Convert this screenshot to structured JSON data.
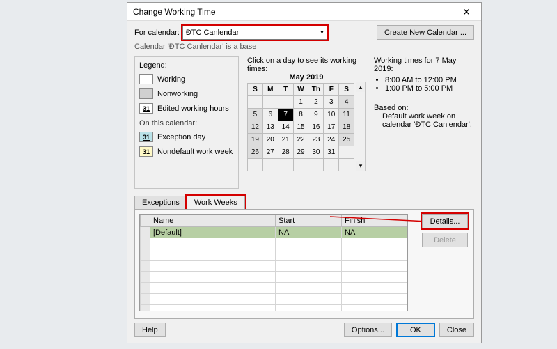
{
  "dialog": {
    "title": "Change Working Time"
  },
  "row1": {
    "forCalendarLabel": "For calendar:",
    "selectedCalendar": "ĐTC Canlendar",
    "createNewBtn": "Create New Calendar ..."
  },
  "subline": "Calendar 'ĐTC Canlendar' is a base",
  "legend": {
    "title": "Legend:",
    "working": "Working",
    "nonworking": "Nonworking",
    "edited": "Edited working hours",
    "editedBadge": "31",
    "onthis": "On this calendar:",
    "exception": "Exception day",
    "exceptionBadge": "31",
    "nondefault": "Nondefault work week",
    "nondefaultBadge": "31"
  },
  "calendar": {
    "prompt": "Click on a day to see its working times:",
    "month": "May 2019",
    "dow": [
      "S",
      "M",
      "T",
      "W",
      "Th",
      "F",
      "S"
    ],
    "weeks": [
      [
        {
          "d": "",
          "c": ""
        },
        {
          "d": "",
          "c": ""
        },
        {
          "d": "",
          "c": ""
        },
        {
          "d": "1",
          "c": ""
        },
        {
          "d": "2",
          "c": ""
        },
        {
          "d": "3",
          "c": ""
        },
        {
          "d": "4",
          "c": "nw"
        }
      ],
      [
        {
          "d": "5",
          "c": "nw"
        },
        {
          "d": "6",
          "c": ""
        },
        {
          "d": "7",
          "c": "sel"
        },
        {
          "d": "8",
          "c": ""
        },
        {
          "d": "9",
          "c": ""
        },
        {
          "d": "10",
          "c": ""
        },
        {
          "d": "11",
          "c": "nw"
        }
      ],
      [
        {
          "d": "12",
          "c": "nw"
        },
        {
          "d": "13",
          "c": ""
        },
        {
          "d": "14",
          "c": ""
        },
        {
          "d": "15",
          "c": ""
        },
        {
          "d": "16",
          "c": ""
        },
        {
          "d": "17",
          "c": ""
        },
        {
          "d": "18",
          "c": "nw"
        }
      ],
      [
        {
          "d": "19",
          "c": "nw"
        },
        {
          "d": "20",
          "c": ""
        },
        {
          "d": "21",
          "c": ""
        },
        {
          "d": "22",
          "c": ""
        },
        {
          "d": "23",
          "c": ""
        },
        {
          "d": "24",
          "c": ""
        },
        {
          "d": "25",
          "c": "nw"
        }
      ],
      [
        {
          "d": "26",
          "c": "nw"
        },
        {
          "d": "27",
          "c": ""
        },
        {
          "d": "28",
          "c": ""
        },
        {
          "d": "29",
          "c": ""
        },
        {
          "d": "30",
          "c": ""
        },
        {
          "d": "31",
          "c": ""
        },
        {
          "d": "",
          "c": ""
        }
      ],
      [
        {
          "d": "",
          "c": ""
        },
        {
          "d": "",
          "c": ""
        },
        {
          "d": "",
          "c": ""
        },
        {
          "d": "",
          "c": ""
        },
        {
          "d": "",
          "c": ""
        },
        {
          "d": "",
          "c": ""
        },
        {
          "d": "",
          "c": ""
        }
      ]
    ]
  },
  "right": {
    "header": "Working times for 7 May 2019:",
    "times": [
      "8:00 AM to 12:00 PM",
      "1:00 PM to 5:00 PM"
    ],
    "basedLabel": "Based on:",
    "basedText": "Default work week on calendar 'ĐTC Canlendar'."
  },
  "tabs": {
    "exceptions": "Exceptions",
    "workweeks": "Work Weeks",
    "cols": {
      "name": "Name",
      "start": "Start",
      "finish": "Finish"
    },
    "rows": [
      {
        "name": "[Default]",
        "start": "NA",
        "finish": "NA"
      }
    ],
    "details": "Details...",
    "delete": "Delete"
  },
  "footer": {
    "help": "Help",
    "options": "Options...",
    "ok": "OK",
    "close": "Close"
  }
}
